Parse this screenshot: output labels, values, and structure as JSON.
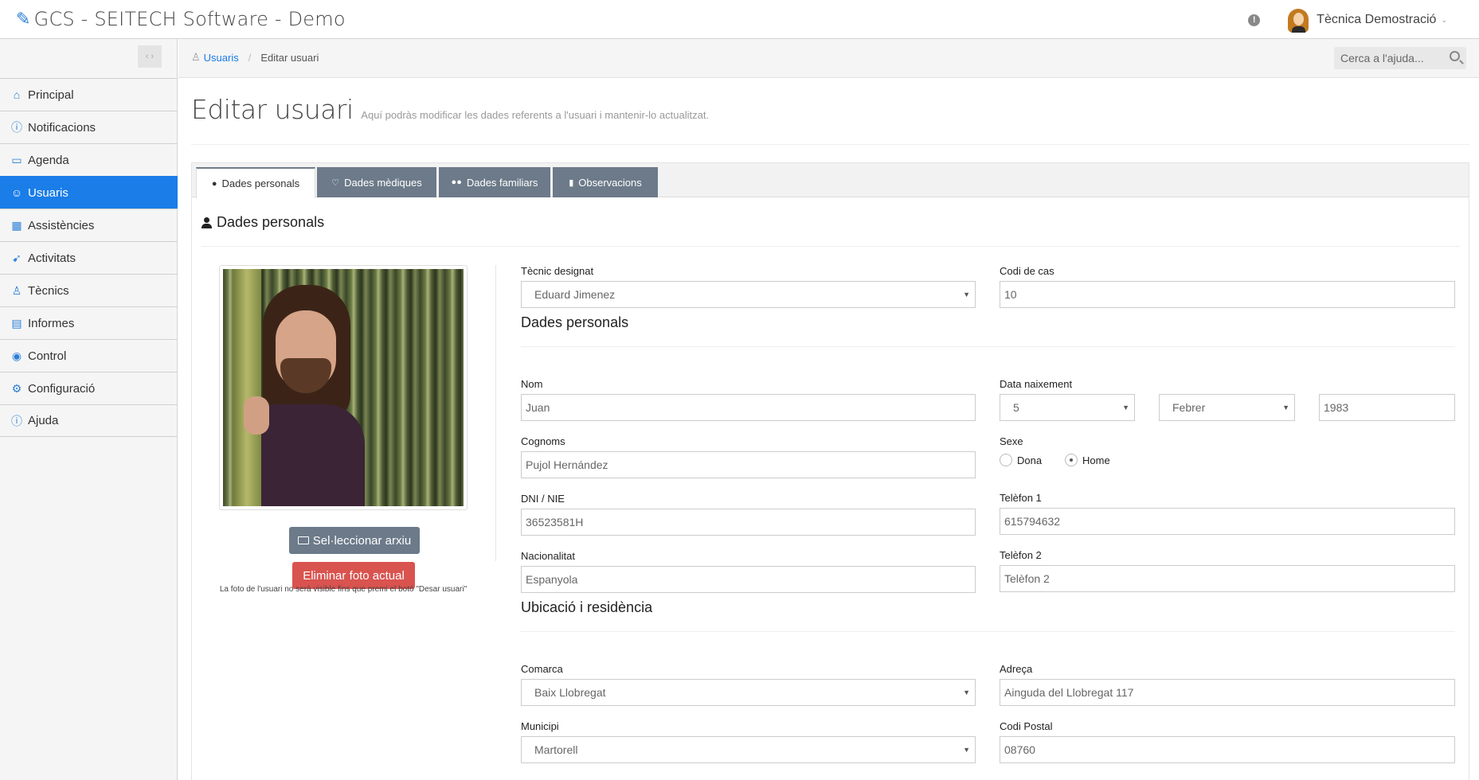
{
  "app": {
    "title": "GCS - SEITECH Software - Demo"
  },
  "user": {
    "name": "Tècnica Demostració",
    "alert_icon": "exclamation-circle-icon"
  },
  "sidebar": {
    "items": [
      {
        "label": "Principal",
        "icon": "home-icon",
        "glyph": "⌂"
      },
      {
        "label": "Notificacions",
        "icon": "exclamation-circle-icon",
        "glyph": "ⓘ"
      },
      {
        "label": "Agenda",
        "icon": "book-icon",
        "glyph": "▭"
      },
      {
        "label": "Usuaris",
        "icon": "users-icon",
        "glyph": "☺",
        "active": true
      },
      {
        "label": "Assistències",
        "icon": "calendar-icon",
        "glyph": "▦"
      },
      {
        "label": "Activitats",
        "icon": "paper-plane-icon",
        "glyph": "➹"
      },
      {
        "label": "Tècnics",
        "icon": "user-icon",
        "glyph": "♙"
      },
      {
        "label": "Informes",
        "icon": "document-icon",
        "glyph": "▤"
      },
      {
        "label": "Control",
        "icon": "eye-icon",
        "glyph": "◉"
      },
      {
        "label": "Configuració",
        "icon": "gear-icon",
        "glyph": "⚙"
      },
      {
        "label": "Ajuda",
        "icon": "info-circle-icon",
        "glyph": "ⓘ"
      }
    ]
  },
  "breadcrumb": {
    "parent": "Usuaris",
    "current": "Editar usuari"
  },
  "search": {
    "placeholder": "Cerca a l'ajuda..."
  },
  "page": {
    "title": "Editar usuari",
    "subtitle": "Aquí podràs modificar les dades referents a l'usuari i mantenir-lo actualitzat."
  },
  "tabs": [
    {
      "label": "Dades personals",
      "icon": "user-icon",
      "active": true
    },
    {
      "label": "Dades mèdiques",
      "icon": "stethoscope-icon"
    },
    {
      "label": "Dades familiars",
      "icon": "users-icon"
    },
    {
      "label": "Observacions",
      "icon": "book-icon"
    }
  ],
  "section": {
    "title": "Dades personals"
  },
  "photo": {
    "select_label": "Sel·leccionar arxiu",
    "delete_label": "Eliminar foto actual",
    "note": "La foto de l'usuari no serà visible fins que premi el botó \"Desar usuari\""
  },
  "form": {
    "tecnic": {
      "label": "Tècnic designat",
      "value": "Eduard Jimenez"
    },
    "codi_cas": {
      "label": "Codi de cas",
      "value": "10"
    },
    "personal_header": "Dades personals",
    "nom": {
      "label": "Nom",
      "value": "Juan"
    },
    "data_naixement": {
      "label": "Data naixement",
      "day": "5",
      "month": "Febrer",
      "year": "1983"
    },
    "cognoms": {
      "label": "Cognoms",
      "value": "Pujol Hernández"
    },
    "sexe": {
      "label": "Sexe",
      "option_a": "Dona",
      "option_b": "Home",
      "selected": "Home"
    },
    "dni": {
      "label": "DNI / NIE",
      "value": "36523581H"
    },
    "telefon1": {
      "label": "Telèfon 1",
      "value": "615794632"
    },
    "nacionalitat": {
      "label": "Nacionalitat",
      "value": "Espanyola"
    },
    "telefon2": {
      "label": "Telèfon 2",
      "placeholder": "Telèfon 2"
    },
    "residence_header": "Ubicació i residència",
    "comarca": {
      "label": "Comarca",
      "value": "Baix Llobregat"
    },
    "adreca": {
      "label": "Adreça",
      "value": "Ainguda del Llobregat 117"
    },
    "municipi": {
      "label": "Municipi",
      "value": "Martorell"
    },
    "codi_postal": {
      "label": "Codi Postal",
      "value": "08760"
    }
  },
  "colors": {
    "accent": "#1a7de8",
    "tab_inactive": "#6c7a89",
    "danger": "#d9534f"
  }
}
